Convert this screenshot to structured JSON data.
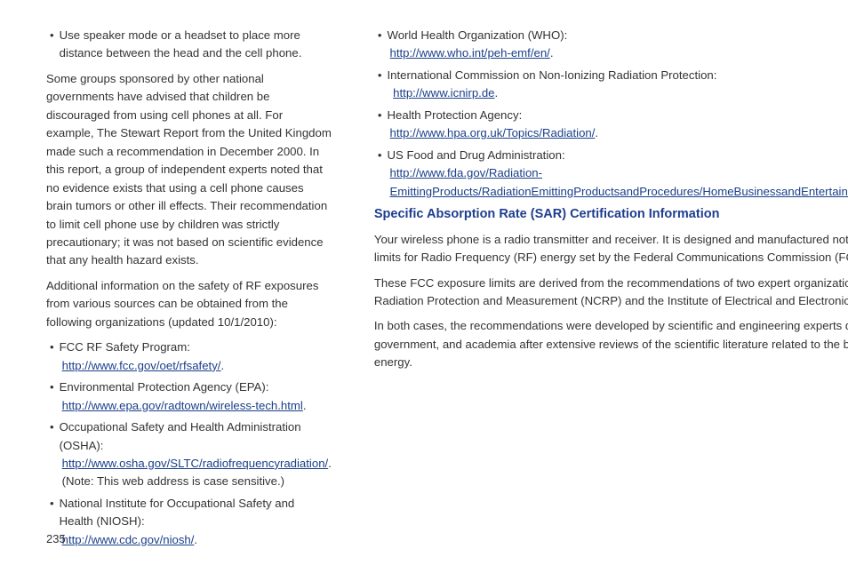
{
  "pageNumber": "235",
  "left": {
    "bullet1": "Use speaker mode or a headset to place more distance between the head and the cell phone.",
    "para1": "Some groups sponsored by other national governments have advised that children be discouraged from using cell phones at all. For example, The Stewart Report from the United Kingdom made such a recommendation in December 2000. In this report, a group of independent experts noted that no evidence exists that using a cell phone causes brain tumors or other ill effects. Their recommendation to limit cell phone use by children was strictly precautionary; it was not based on scientific evidence that any health hazard exists.",
    "para2": "Additional information on the safety of RF exposures from various sources can be obtained from the following organizations (updated 10/1/2010):",
    "org1_label": "FCC RF Safety Program:",
    "org1_link": "http://www.fcc.gov/oet/rfsafety/",
    "org2_label": "Environmental Protection Agency (EPA):",
    "org2_link": "http://www.epa.gov/radtown/wireless-tech.html",
    "org3_label": "Occupational Safety and Health Administration (OSHA):",
    "org3_link": "http://www.osha.gov/SLTC/radiofrequencyradiation/",
    "org3_note": "(Note: This web address is case sensitive.)",
    "org4_label": "National Institute for Occupational Safety and Health (NIOSH):",
    "org4_link": "http://www.cdc.gov/niosh/"
  },
  "right": {
    "org5_label": "World Health Organization (WHO):",
    "org5_link": "http://www.who.int/peh-emf/en/",
    "org6_label": "International Commission on Non-Ionizing Radiation Protection:",
    "org6_link": "http://www.icnirp.de",
    "org7_label": "Health Protection Agency:",
    "org7_link": "http://www.hpa.org.uk/Topics/Radiation/",
    "org8_label": "US Food and Drug Administration:",
    "org8_link": "http://www.fda.gov/Radiation-EmittingProducts/RadiationEmittingProductsandProcedures/HomeBusinessandEntertainment/CellPhones/default.htm",
    "heading": "Specific Absorption Rate (SAR) Certification Information",
    "para3": "Your wireless phone is a radio transmitter and receiver. It is designed and manufactured not to exceed the exposure limits for Radio Frequency (RF) energy set by the Federal Communications Commission (FCC) of the U.S. Government.",
    "para4": "These FCC exposure limits are derived from the recommendations of two expert organizations: the National Council on Radiation Protection and Measurement (NCRP) and the Institute of Electrical and Electronics Engineers (IEEE).",
    "para5": "In both cases, the recommendations were developed by scientific and engineering experts drawn from industry, government, and academia after extensive reviews of the scientific literature related to the biological effects of RF energy."
  }
}
